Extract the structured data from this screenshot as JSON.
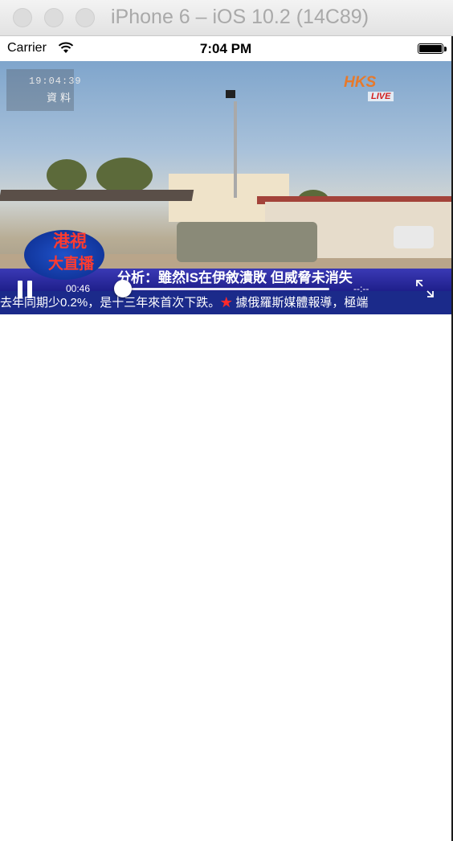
{
  "window": {
    "title": "iPhone 6 – iOS 10.2 (14C89)"
  },
  "statusbar": {
    "carrier": "Carrier",
    "time": "7:04 PM",
    "wifi_icon": "wifi-icon",
    "battery_icon": "battery-icon"
  },
  "video": {
    "osd_time": "19:04:39",
    "osd_label": "資料",
    "channel_logo": "HKS",
    "live_badge": "LIVE",
    "channel_name_line1": "港視",
    "channel_name_line2": "大直播",
    "headline": "分析：雖然IS在伊敘潰敗 但威脅未消失",
    "ticker_part1": "去年同期少0.2%，是十三年來首次下跌。",
    "ticker_star": "★",
    "ticker_part2": " 據俄羅斯媒體報導，極端"
  },
  "player": {
    "elapsed": "00:46",
    "remaining": "--:--",
    "progress": 0.0,
    "pause_icon": "pause-icon",
    "fullscreen_icon": "fullscreen-icon"
  }
}
